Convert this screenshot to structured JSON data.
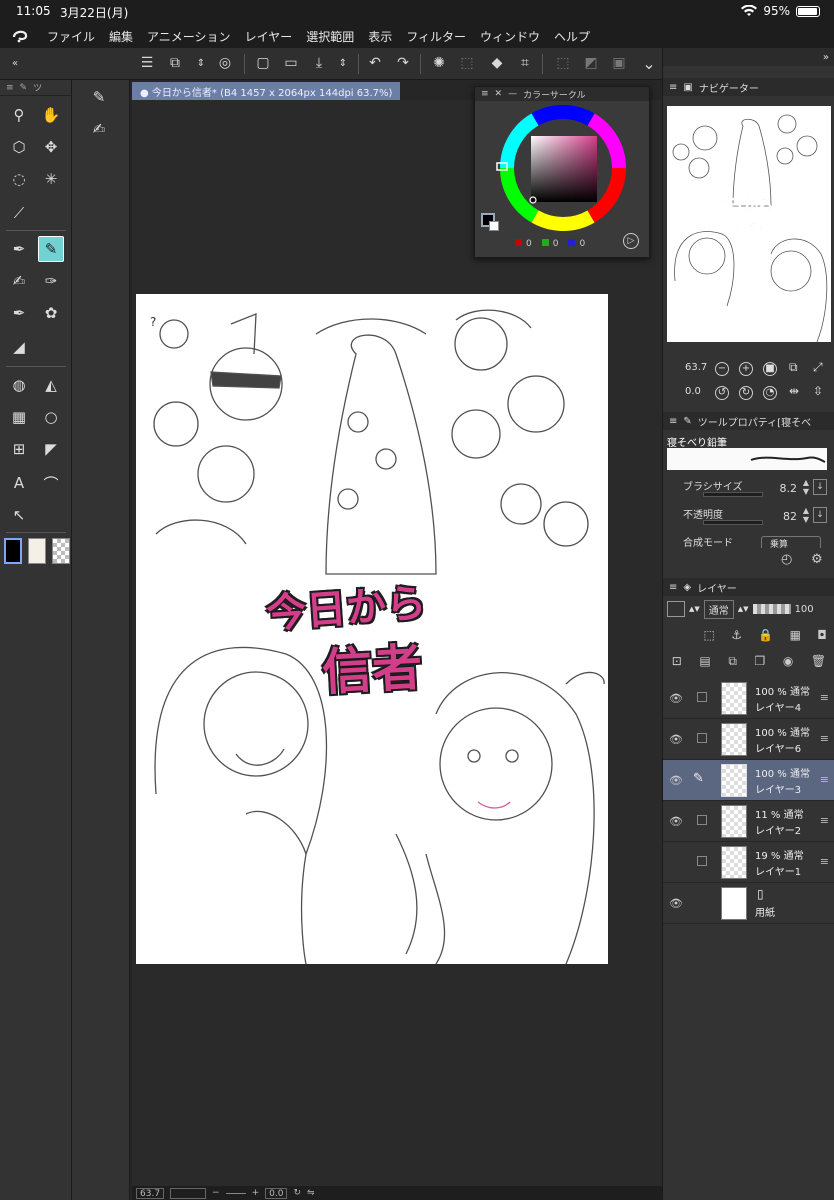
{
  "status_bar": {
    "time": "11:05",
    "date": "3月22日(月)",
    "wifi_icon": "wifi-icon",
    "battery": "95%"
  },
  "menu": [
    "ファイル",
    "編集",
    "アニメーション",
    "レイヤー",
    "選択範囲",
    "表示",
    "フィルター",
    "ウィンドウ",
    "ヘルプ"
  ],
  "document": {
    "tab_title": "今日から信者* (B4 1457 x 2064px 144dpi 63.7%)"
  },
  "artwork": {
    "title_line1": "今日から",
    "title_line2": "信者",
    "question_mark": "?"
  },
  "color_circle": {
    "title": "カラーサークル",
    "r": "0",
    "g": "0",
    "b": "0",
    "accent": "#d23e89"
  },
  "navigator": {
    "title": "ナビゲーター",
    "zoom": "63.7",
    "rotation": "0.0"
  },
  "tool_property": {
    "title": "ツールプロパティ[寝そべ",
    "brush_name": "寝そべり鉛筆",
    "brush_size_label": "ブラシサイズ",
    "brush_size_value": "8.2",
    "opacity_label": "不透明度",
    "opacity_value": "82",
    "blend_label": "合成モード",
    "blend_value": "乗算"
  },
  "layer_panel": {
    "title": "レイヤー",
    "blend_mode": "通常",
    "opacity": "100",
    "layers": [
      {
        "pct": "100 % 通常",
        "name": "レイヤー4",
        "visible": true
      },
      {
        "pct": "100 % 通常",
        "name": "レイヤー6",
        "visible": true
      },
      {
        "pct": "100 % 通常",
        "name": "レイヤー3",
        "visible": true,
        "selected": true
      },
      {
        "pct": "11 % 通常",
        "name": "レイヤー2",
        "visible": true
      },
      {
        "pct": "19 % 通常",
        "name": "レイヤー1",
        "visible": false
      },
      {
        "pct": "",
        "name": "用紙",
        "visible": true
      }
    ]
  },
  "bottom_bar": {
    "zoom": "63.7",
    "minus": "−",
    "plus": "+",
    "rotation": "0.0"
  },
  "tool_panel_head": "ツ"
}
